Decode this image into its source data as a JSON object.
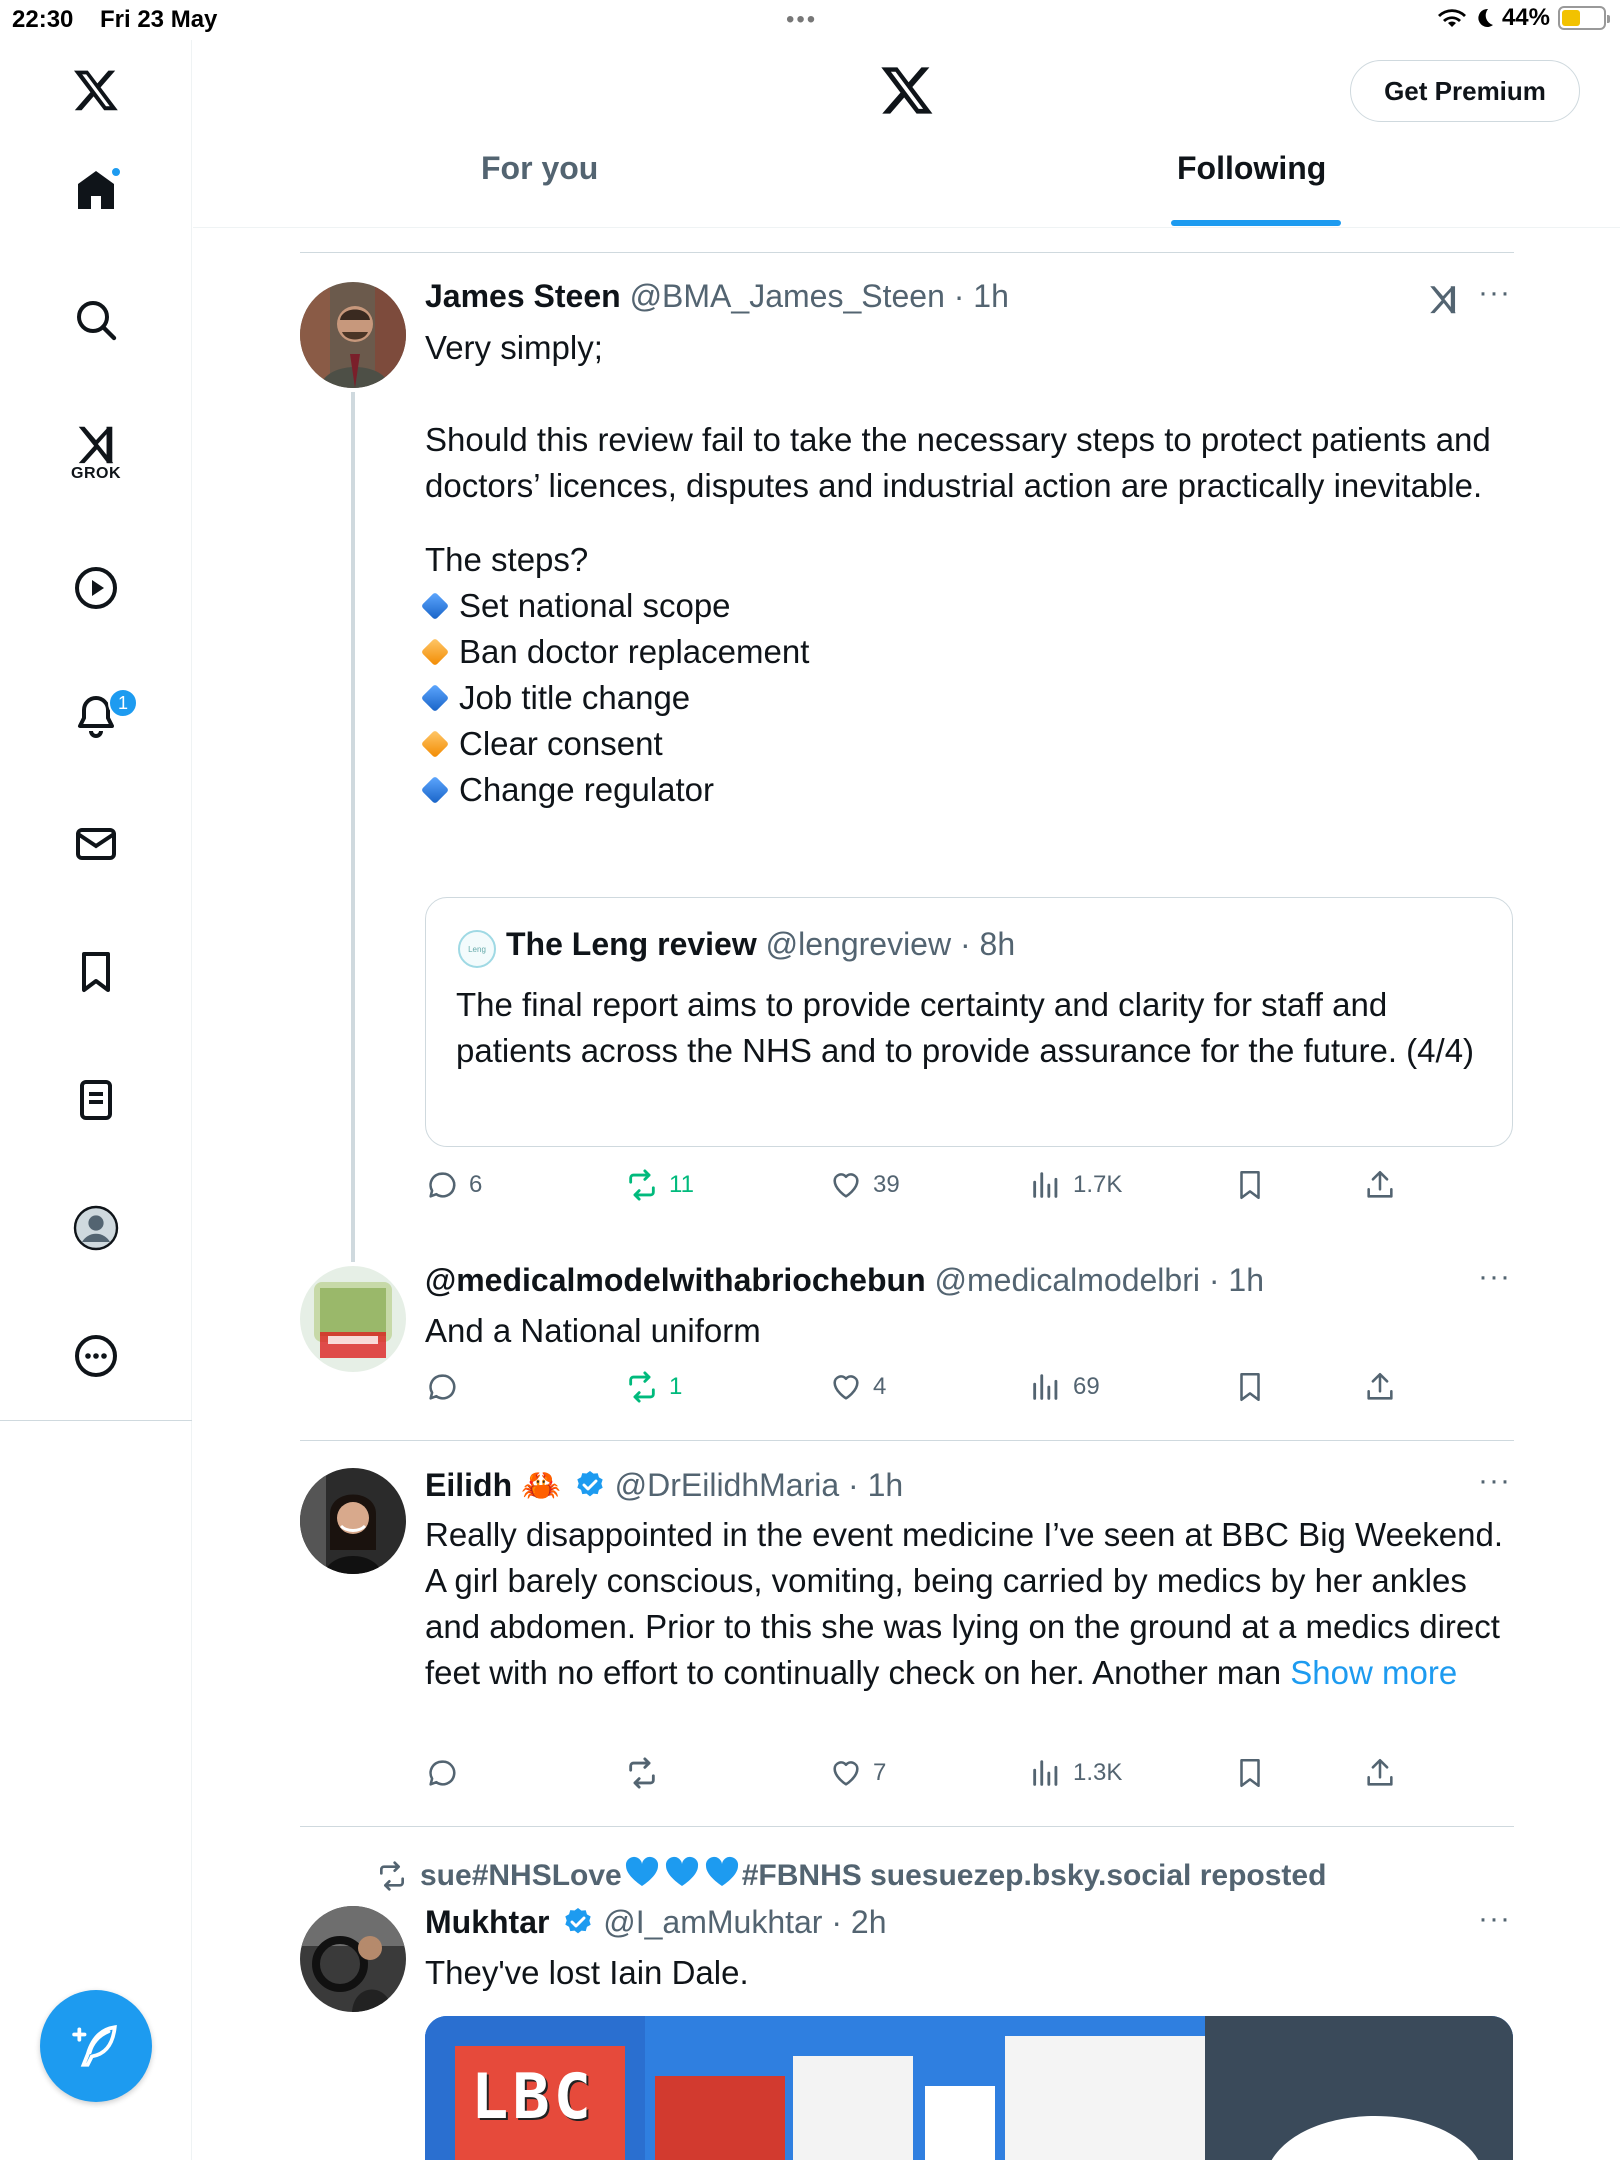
{
  "status": {
    "time": "22:30",
    "date": "Fri 23 May",
    "battery": "44%",
    "battery_level": 0.44
  },
  "nav": {
    "grok_label": "GROK",
    "notifications_count": "1"
  },
  "header": {
    "premium_label": "Get Premium",
    "tabs": [
      "For you",
      "Following"
    ],
    "active_tab": "Following"
  },
  "tweets": [
    {
      "name": "James Steen",
      "handle": "@BMA_James_Steen",
      "time": "· 1h",
      "line1": "Very simply;",
      "para1": "Should this review fail to take the necessary steps to protect patients and doctors’ licences, disputes and industrial action are practically inevitable.",
      "steps_title": "The steps?",
      "steps": [
        {
          "text": "Set national scope",
          "color": "blue"
        },
        {
          "text": "Ban doctor replacement",
          "color": "orange"
        },
        {
          "text": "Job title change",
          "color": "blue"
        },
        {
          "text": "Clear consent",
          "color": "orange"
        },
        {
          "text": "Change regulator",
          "color": "blue"
        }
      ],
      "quote": {
        "name": "The Leng review",
        "handle": "@lengreview",
        "time": "· 8h",
        "text": "The final report aims to provide certainty and clarity for staff and patients across the NHS and to provide assurance for the future. (4/4)"
      },
      "replies": "6",
      "reposts": "11",
      "likes": "39",
      "views": "1.7K"
    },
    {
      "name": "@medicalmodelwithabriochebun",
      "handle": "@medicalmodelbri",
      "time": "· 1h",
      "text": "And a National uniform",
      "replies": "",
      "reposts": "1",
      "likes": "4",
      "views": "69"
    },
    {
      "name": "Eilidh",
      "name_emoji": "🦀",
      "handle": "@DrEilidhMaria",
      "time": "· 1h",
      "text": "Really disappointed in the event medicine I’ve seen at BBC Big Weekend. A girl barely conscious, vomiting, being carried by medics by her ankles and abdomen. Prior to this she was lying on the ground at a medics direct feet with no effort to continually check on her. Another man",
      "show_more": "Show more",
      "replies": "",
      "reposts": "",
      "likes": "7",
      "views": "1.3K"
    },
    {
      "repost_by_a": "sue#NHSLove",
      "repost_by_b": "#FBNHS suesuezep.bsky.social reposted",
      "name": "Mukhtar",
      "handle": "@I_amMukhtar",
      "time": "· 2h",
      "text": "They've lost Iain Dale.",
      "media_label": "LBC"
    }
  ],
  "colors": {
    "accent": "#1d9bf0",
    "repost_green": "#00ba7c",
    "muted": "#536471"
  }
}
